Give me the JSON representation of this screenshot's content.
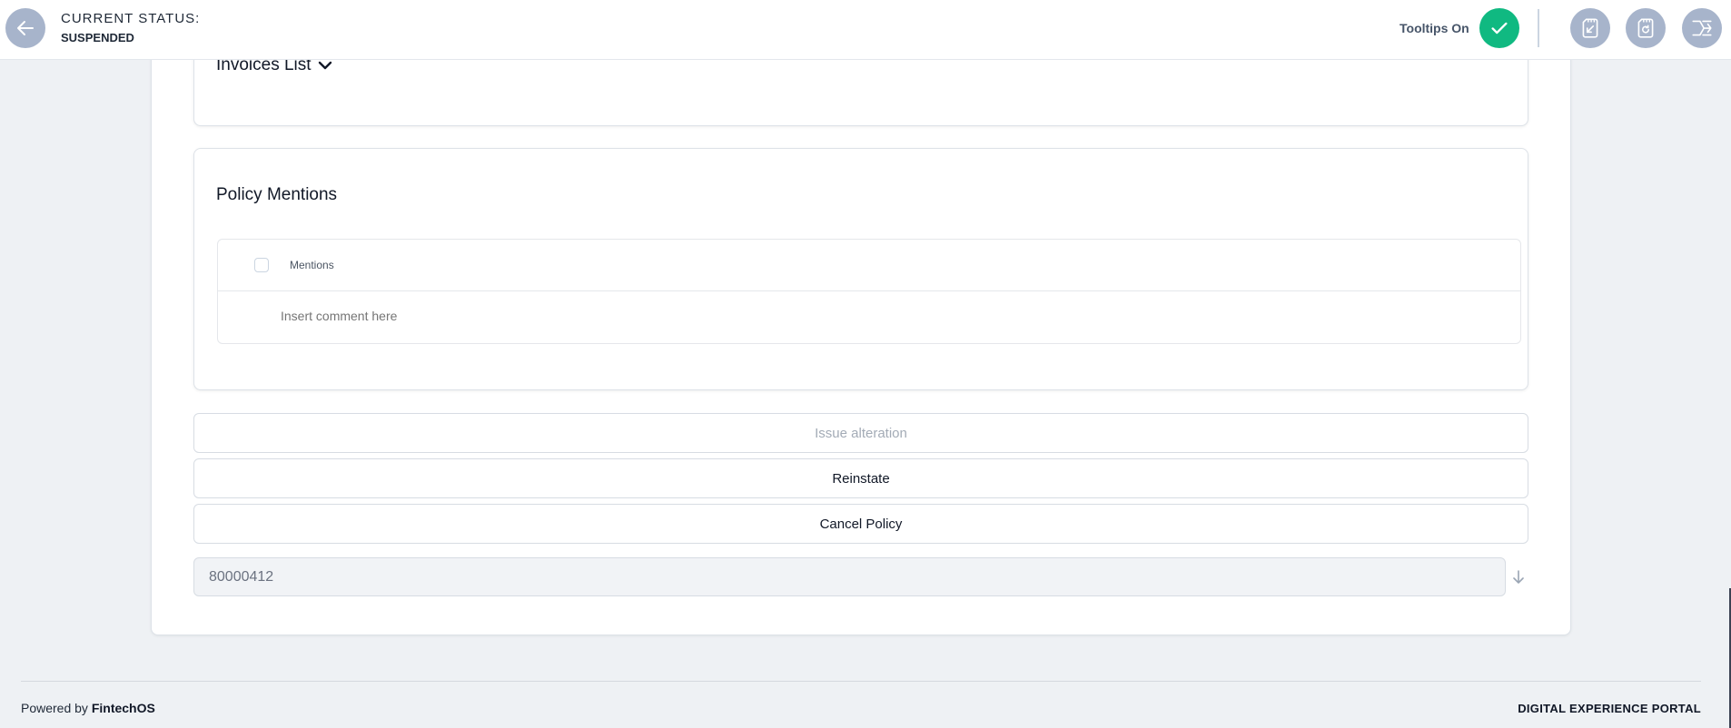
{
  "header": {
    "status_label": "CURRENT STATUS:",
    "status_value": "SUSPENDED",
    "tooltips_label": "Tooltips On",
    "icons": [
      "back-arrow-icon",
      "check-icon",
      "sd-card-arrow-icon",
      "sd-card-refresh-icon",
      "split-arrows-icon"
    ]
  },
  "invoices": {
    "title": "Invoices List"
  },
  "mentions": {
    "title": "Policy Mentions",
    "column_header": "Mentions",
    "comment_placeholder": "Insert comment here"
  },
  "actions": {
    "issue_alteration": "Issue alteration",
    "reinstate": "Reinstate",
    "cancel_policy": "Cancel Policy"
  },
  "policy_number": "80000412",
  "footer": {
    "powered_prefix": "Powered by",
    "powered_brand": "FintechOS",
    "portal_name": "DIGITAL EXPERIENCE PORTAL"
  },
  "colors": {
    "accent_green": "#10b981",
    "icon_button": "#a7b4cb",
    "background": "#eef1f4"
  }
}
